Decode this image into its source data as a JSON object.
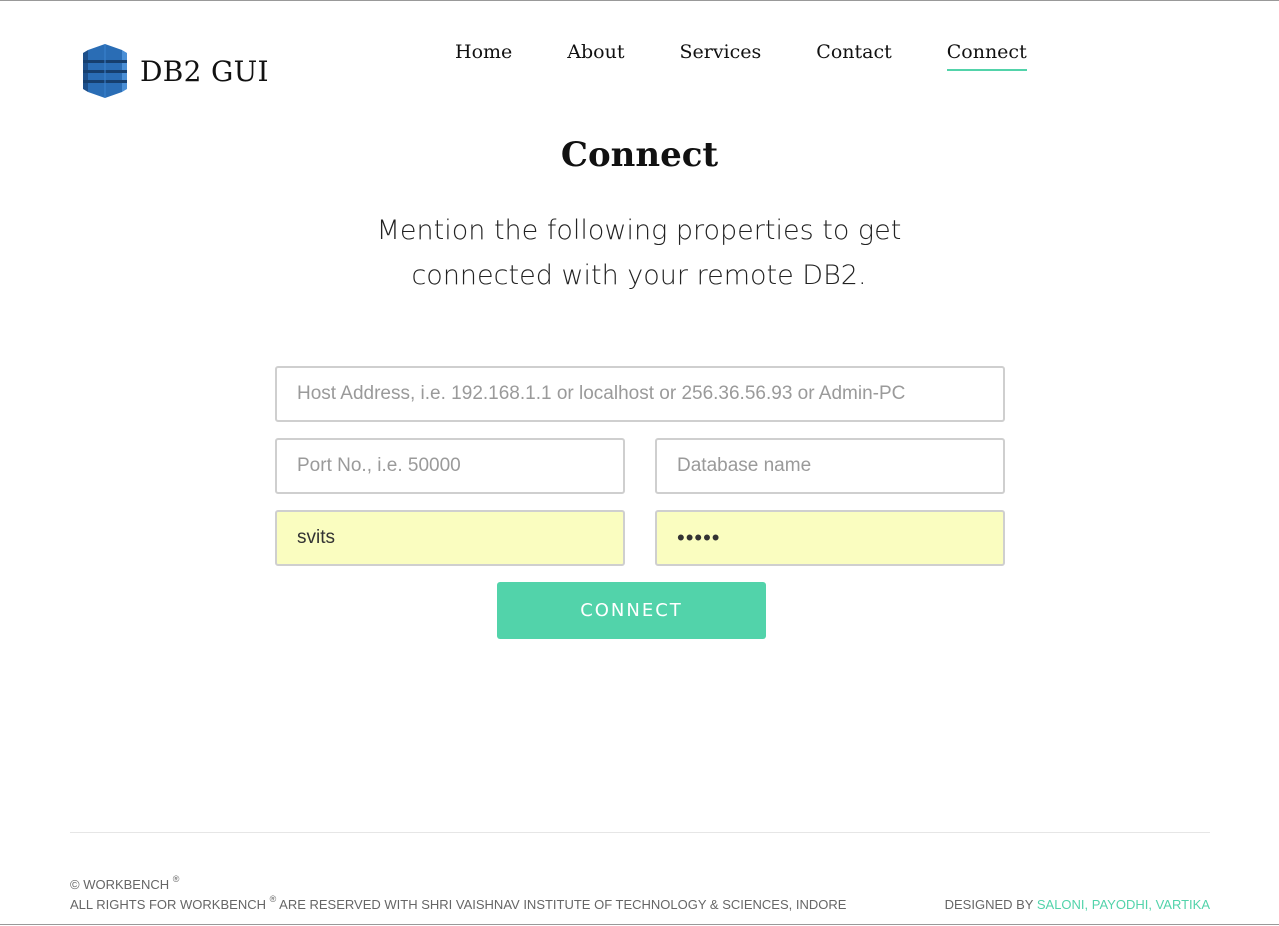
{
  "header": {
    "brand": "DB2 GUI",
    "logo_icon": "database-icon",
    "nav": [
      {
        "label": "Home",
        "active": false
      },
      {
        "label": "About",
        "active": false
      },
      {
        "label": "Services",
        "active": false
      },
      {
        "label": "Contact",
        "active": false
      },
      {
        "label": "Connect",
        "active": true
      }
    ]
  },
  "main": {
    "title": "Connect",
    "subtitle": "Mention the following properties to get connected with your remote DB2."
  },
  "form": {
    "host": {
      "placeholder": "Host Address, i.e. 192.168.1.1 or localhost or 256.36.56.93 or Admin-PC",
      "value": ""
    },
    "port": {
      "placeholder": "Port No., i.e. 50000",
      "value": ""
    },
    "database": {
      "placeholder": "Database name",
      "value": ""
    },
    "username": {
      "value": "svits"
    },
    "password": {
      "value": "abcde"
    },
    "submit_label": "CONNECT"
  },
  "footer": {
    "copyright": "© WORKBENCH",
    "registered": "®",
    "rights_prefix": "ALL RIGHTS FOR WORKBENCH",
    "rights_suffix": "ARE RESERVED WITH SHRI VAISHNAV INSTITUTE OF TECHNOLOGY & SCIENCES, INDORE",
    "designed_by": "DESIGNED BY",
    "designers": "SALONI, PAYODHI, VARTIKA"
  },
  "colors": {
    "accent": "#52d3aa",
    "autofill": "#fafdc0",
    "logo_blue": "#2a6db5"
  }
}
